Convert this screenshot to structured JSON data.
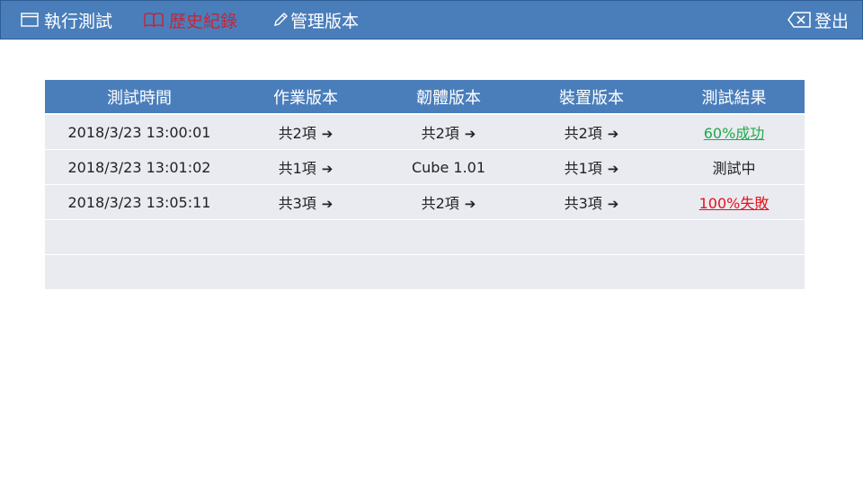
{
  "nav": {
    "run_test": "執行測試",
    "history": "歷史紀錄",
    "manage_versions": "管理版本",
    "logout": "登出"
  },
  "colors": {
    "header_blue": "#4a7ebb",
    "active_red": "#c0283b",
    "success_green": "#1faa48",
    "fail_red": "#e8101a",
    "row_bg": "#e9ebf1"
  },
  "icons": {
    "run_test": "window-icon",
    "history": "book-icon",
    "manage_versions": "pencil-icon",
    "logout": "logout-icon",
    "row_arrow": "arrow-right-circle-icon"
  },
  "table": {
    "columns": [
      "測試時間",
      "作業版本",
      "韌體版本",
      "裝置版本",
      "測試結果"
    ],
    "rows": [
      {
        "time": "2018/3/23 13:00:01",
        "os": "共2項",
        "os_link": true,
        "firmware": "共2項",
        "firmware_link": true,
        "device": "共2項",
        "device_link": true,
        "result": "60%成功",
        "result_status": "success"
      },
      {
        "time": "2018/3/23 13:01:02",
        "os": "共1項",
        "os_link": true,
        "firmware": "Cube 1.01",
        "firmware_link": false,
        "device": "共1項",
        "device_link": true,
        "result": "測試中",
        "result_status": "running"
      },
      {
        "time": "2018/3/23 13:05:11",
        "os": "共3項",
        "os_link": true,
        "firmware": "共2項",
        "firmware_link": true,
        "device": "共3項",
        "device_link": true,
        "result": "100%失敗",
        "result_status": "fail"
      }
    ],
    "empty_rows": 2
  }
}
